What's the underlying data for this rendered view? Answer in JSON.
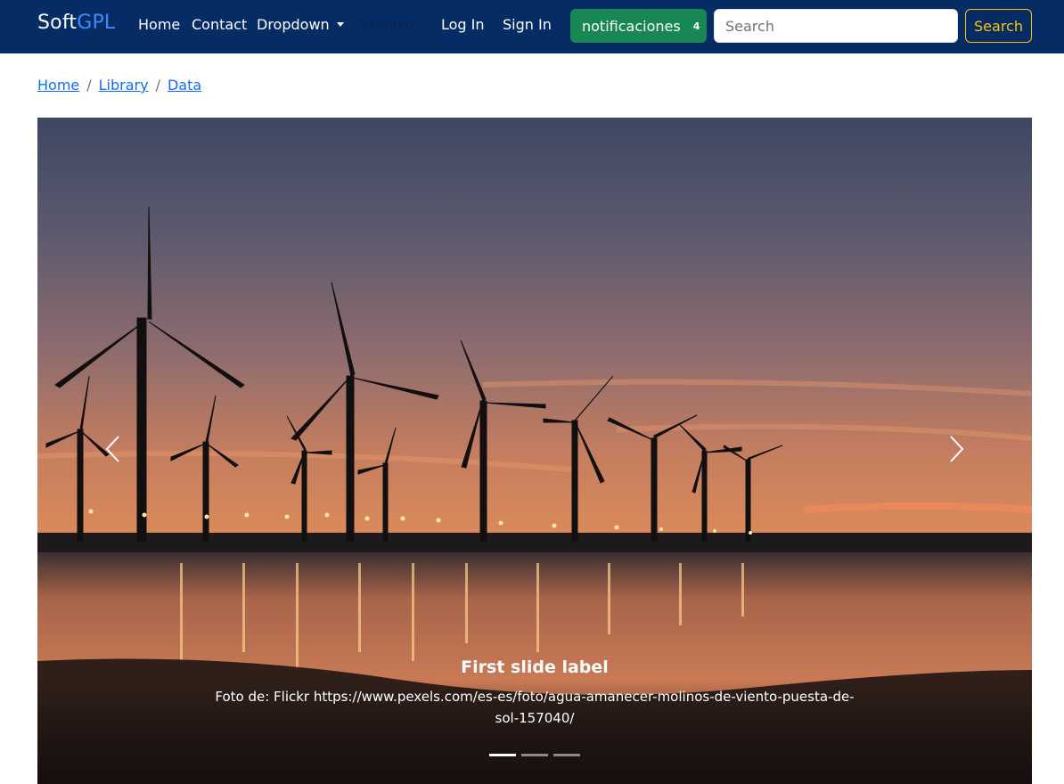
{
  "navbar": {
    "brand_part1": "Soft",
    "brand_part2": "GPL",
    "links": [
      {
        "label": "Home"
      },
      {
        "label": "Contact"
      },
      {
        "label": "Dropdown"
      },
      {
        "label": "Disabled"
      },
      {
        "label": "Log In"
      },
      {
        "label": "Sign In"
      }
    ],
    "notifications": {
      "label": "notificaciones",
      "count": "4"
    },
    "search": {
      "placeholder": "Search",
      "button_label": "Search"
    },
    "colors": {
      "background": "#052c65",
      "brand_accent": "#3d8bfd",
      "success": "#198754",
      "warning": "#ffc107"
    }
  },
  "breadcrumb": {
    "items": [
      "Home",
      "Library",
      "Data"
    ],
    "separator": "/"
  },
  "carousel": {
    "caption_title": "First slide label",
    "caption_text": "Foto de: Flickr https://www.pexels.com/es-es/foto/agua-amanecer-molinos-de-viento-puesta-de-sol-157040/",
    "slide_count": 3,
    "active_slide": 1,
    "icons": {
      "prev": "chevron-left-icon",
      "next": "chevron-right-icon"
    }
  }
}
